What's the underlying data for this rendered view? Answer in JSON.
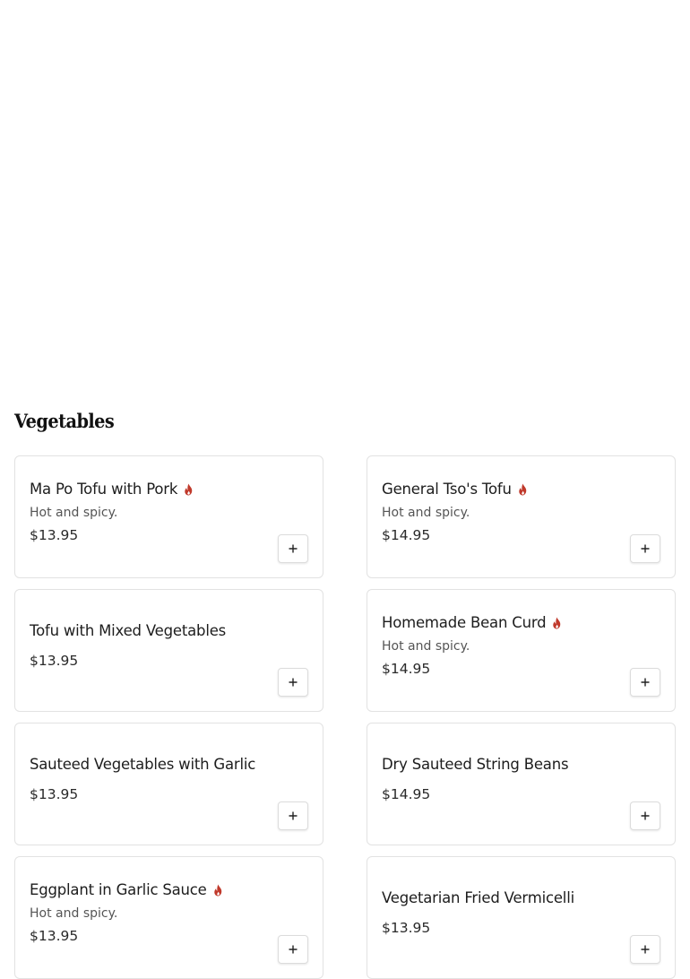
{
  "section": {
    "title": "Vegetables"
  },
  "colors": {
    "spicy_icon": "#c0392b",
    "card_border": "#e2e2e2"
  },
  "items": [
    {
      "name": "Ma Po Tofu with Pork",
      "spicy": true,
      "description": "Hot and spicy.",
      "price": "$13.95",
      "add_icon": "plus-icon"
    },
    {
      "name": "General Tso's Tofu",
      "spicy": true,
      "description": "Hot and spicy.",
      "price": "$14.95",
      "add_icon": "plus-icon"
    },
    {
      "name": "Tofu with Mixed Vegetables",
      "spicy": false,
      "description": "",
      "price": "$13.95",
      "add_icon": "plus-icon"
    },
    {
      "name": "Homemade Bean Curd",
      "spicy": true,
      "description": "Hot and spicy.",
      "price": "$14.95",
      "add_icon": "plus-icon"
    },
    {
      "name": "Sauteed Vegetables with Garlic",
      "spicy": false,
      "description": "",
      "price": "$13.95",
      "add_icon": "plus-icon"
    },
    {
      "name": "Dry Sauteed String Beans",
      "spicy": false,
      "description": "",
      "price": "$14.95",
      "add_icon": "plus-icon"
    },
    {
      "name": "Eggplant in Garlic Sauce",
      "spicy": true,
      "description": "Hot and spicy.",
      "price": "$13.95",
      "add_icon": "plus-icon"
    },
    {
      "name": "Vegetarian Fried Vermicelli",
      "spicy": false,
      "description": "",
      "price": "$13.95",
      "add_icon": "plus-icon"
    }
  ]
}
